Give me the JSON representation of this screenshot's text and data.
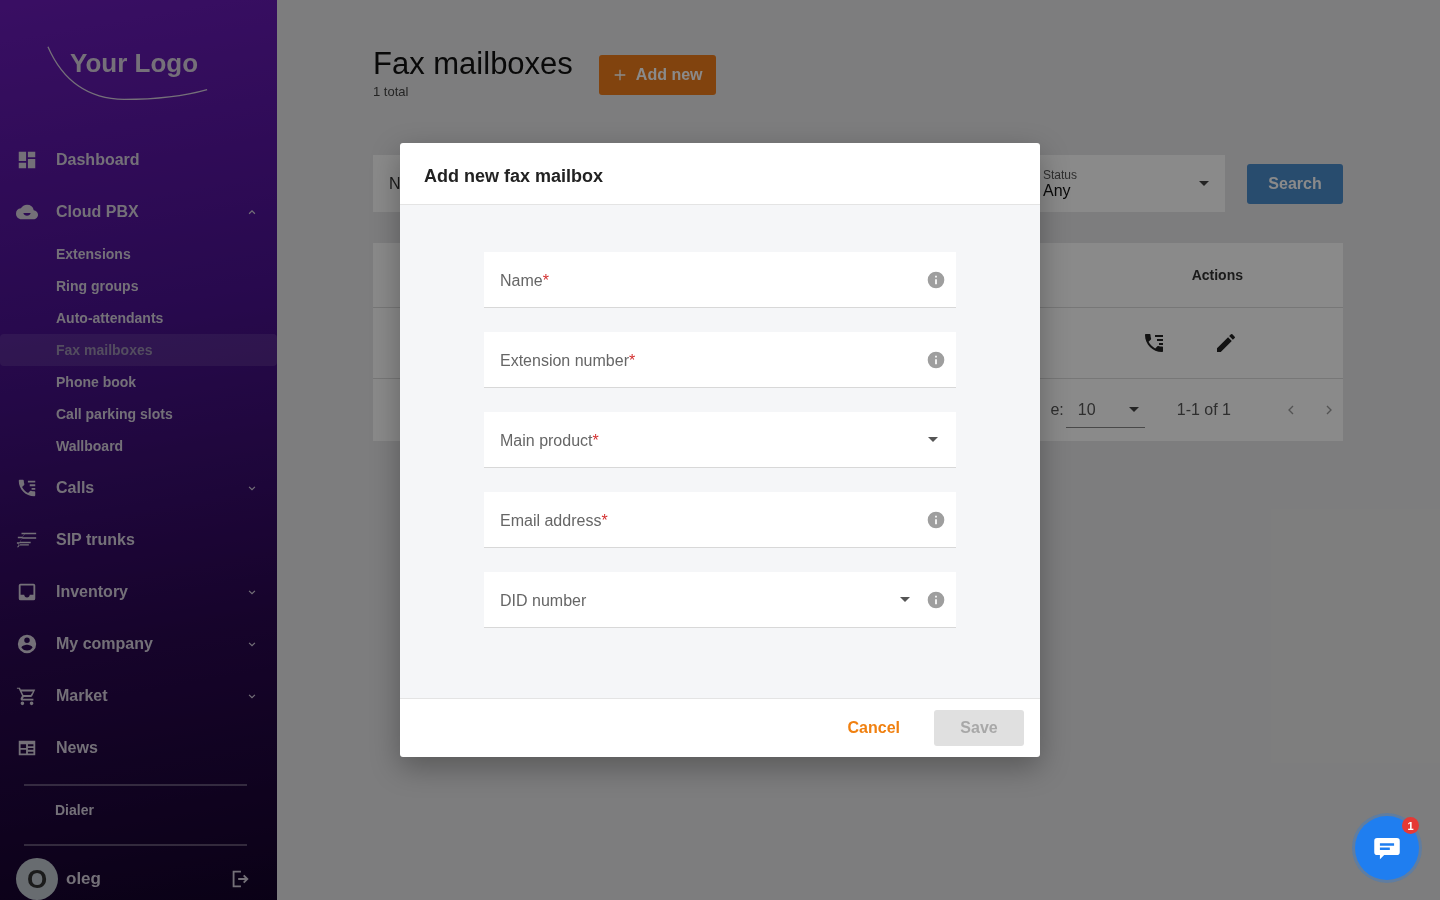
{
  "sidebar": {
    "logo": "Your Logo",
    "items": [
      {
        "label": "Dashboard",
        "kind": "link"
      },
      {
        "label": "Cloud PBX",
        "kind": "group",
        "expanded": true,
        "children": [
          {
            "label": "Extensions",
            "selected": false
          },
          {
            "label": "Ring groups",
            "selected": false
          },
          {
            "label": "Auto-attendants",
            "selected": false
          },
          {
            "label": "Fax mailboxes",
            "selected": true
          },
          {
            "label": "Phone book",
            "selected": false
          },
          {
            "label": "Call parking slots",
            "selected": false
          },
          {
            "label": "Wallboard",
            "selected": false
          }
        ]
      },
      {
        "label": "Calls",
        "kind": "group",
        "expanded": false
      },
      {
        "label": "SIP trunks",
        "kind": "link"
      },
      {
        "label": "Inventory",
        "kind": "group",
        "expanded": false
      },
      {
        "label": "My company",
        "kind": "group",
        "expanded": false
      },
      {
        "label": "Market",
        "kind": "group",
        "expanded": false
      },
      {
        "label": "News",
        "kind": "link"
      }
    ],
    "footer_link": "Dialer",
    "user": {
      "avatar_letter": "O",
      "name": "oleg"
    }
  },
  "page": {
    "title": "Fax mailboxes",
    "subtitle": "1 total",
    "add_button": "Add new",
    "filters": {
      "field_1_visible": "N",
      "status": {
        "label": "Status",
        "value": "Any"
      },
      "search_button": "Search"
    },
    "table": {
      "columns": [
        "Actions"
      ],
      "footer": {
        "label_visible": "e:",
        "per_page": "10",
        "range": "1-1 of 1"
      }
    }
  },
  "dialog": {
    "title": "Add new fax mailbox",
    "fields": [
      {
        "label": "Name",
        "required_mark": "*",
        "kind": "text",
        "info": true
      },
      {
        "label": "Extension number",
        "required_mark": "*",
        "kind": "text",
        "info": true
      },
      {
        "label": "Main product",
        "required_mark": "*",
        "kind": "select",
        "info": false
      },
      {
        "label": "Email address",
        "required_mark": "*",
        "kind": "text",
        "info": true
      },
      {
        "label": "DID number",
        "kind": "select",
        "info": true
      }
    ],
    "buttons": [
      {
        "label": "Cancel",
        "kind": "text",
        "disabled": false
      },
      {
        "label": "Save",
        "kind": "filled",
        "disabled": true
      }
    ]
  },
  "chat": {
    "badge": "1"
  }
}
